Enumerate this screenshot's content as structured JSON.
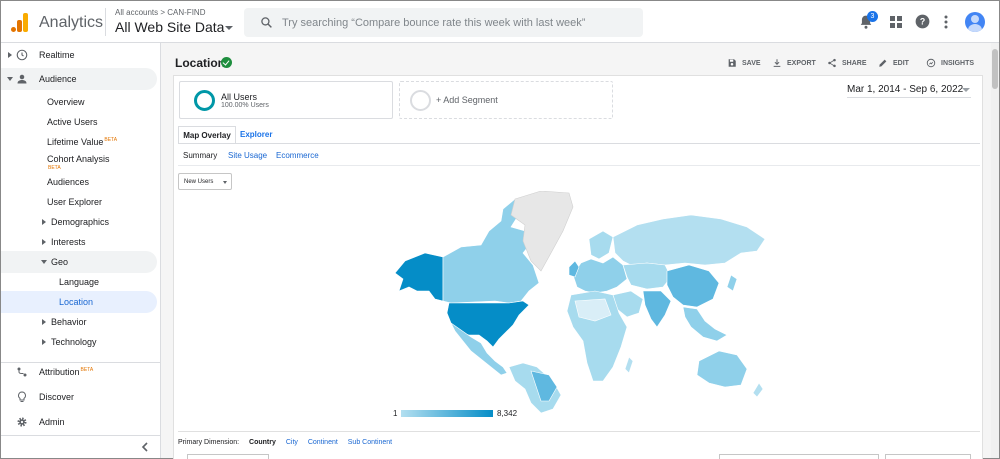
{
  "header": {
    "app_name": "Analytics",
    "account_crumb": "All accounts > CAN-FIND",
    "property": "All Web Site Data",
    "search_placeholder": "Try searching “Compare bounce rate this week with last week”",
    "notification_count": "3"
  },
  "sidebar": {
    "items": [
      {
        "label": "Realtime"
      },
      {
        "label": "Audience"
      },
      {
        "label": "Overview"
      },
      {
        "label": "Active Users"
      },
      {
        "label": "Lifetime Value",
        "beta": "BETA"
      },
      {
        "label": "Cohort Analysis",
        "beta": "BETA"
      },
      {
        "label": "Audiences"
      },
      {
        "label": "User Explorer"
      },
      {
        "label": "Demographics"
      },
      {
        "label": "Interests"
      },
      {
        "label": "Geo"
      },
      {
        "label": "Language"
      },
      {
        "label": "Location"
      },
      {
        "label": "Behavior"
      },
      {
        "label": "Technology"
      },
      {
        "label": "Attribution",
        "beta": "BETA"
      },
      {
        "label": "Discover"
      },
      {
        "label": "Admin"
      }
    ]
  },
  "report": {
    "title": "Location",
    "actions": {
      "save": "SAVE",
      "export": "EXPORT",
      "share": "SHARE",
      "edit": "EDIT",
      "insights": "INSIGHTS"
    },
    "segment": {
      "name": "All Users",
      "share": "100.00% Users",
      "add": "+ Add Segment"
    },
    "date_range": "Mar 1, 2014 - Sep 6, 2022",
    "tabs": [
      "Map Overlay",
      "Explorer"
    ],
    "subtabs": [
      "Summary",
      "Site Usage",
      "Ecommerce"
    ],
    "metric": "New Users",
    "legend": {
      "min": "1",
      "max": "8,342"
    },
    "primary_dimension": {
      "label": "Primary Dimension:",
      "options": [
        "Country",
        "City",
        "Continent",
        "Sub Continent"
      ]
    }
  },
  "colors": {
    "accent": "#1a73e8",
    "map_high": "#058dc7",
    "map_low": "#b3dff0",
    "segment_ring": "#0097a7",
    "logo_orange": "#e37400",
    "logo_yellow": "#f9ab00"
  }
}
